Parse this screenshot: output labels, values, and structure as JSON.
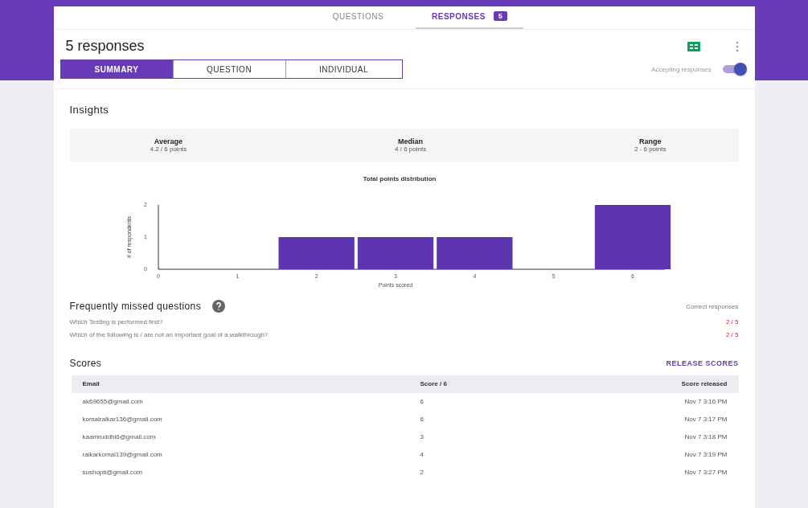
{
  "top_tabs": [
    {
      "label": "QUESTIONS",
      "selected": false
    },
    {
      "label": "RESPONSES",
      "selected": true,
      "badge": "5"
    }
  ],
  "title": "5 responses",
  "views": [
    {
      "label": "SUMMARY",
      "selected": true
    },
    {
      "label": "QUESTION",
      "selected": false
    },
    {
      "label": "INDIVIDUAL",
      "selected": false
    }
  ],
  "accepting": {
    "label": "Accepting responses",
    "on": true
  },
  "insights": {
    "title": "Insights",
    "stats": [
      {
        "label": "Average",
        "value": "4.2 / 6 points"
      },
      {
        "label": "Median",
        "value": "4 / 6 points"
      },
      {
        "label": "Range",
        "value": "2 - 6 points"
      }
    ],
    "chart_data": {
      "type": "bar",
      "title": "Total points distribution",
      "xlabel": "Points scored",
      "ylabel": "# of respondents",
      "categories": [
        "0",
        "1",
        "2",
        "3",
        "4",
        "5",
        "6"
      ],
      "values": [
        0,
        0,
        1,
        1,
        1,
        0,
        2
      ],
      "yticks": [
        0,
        1,
        2
      ],
      "ylim": [
        0,
        2
      ]
    }
  },
  "missed": {
    "title": "Frequently missed questions",
    "column": "Correct responses",
    "rows": [
      {
        "question": "Which Testing is performed first?",
        "correct": "2 / 5"
      },
      {
        "question": "Which of the following is / are not an important goal of a walkthrough?",
        "correct": "2 / 5"
      }
    ]
  },
  "scores": {
    "title": "Scores",
    "action": "RELEASE SCORES",
    "columns": [
      "Email",
      "Score / 6",
      "Score released"
    ],
    "rows": [
      [
        "ak69655@gmail.com",
        "6",
        "Nov 7 3:16 PM"
      ],
      [
        "komalraikar136@gmail.com",
        "6",
        "Nov 7 3:17 PM"
      ],
      [
        "kaamruddhi6@gmail.com",
        "3",
        "Nov 7 3:18 PM"
      ],
      [
        "raikarkomal139@gmail.com",
        "4",
        "Nov 7 3:19 PM"
      ],
      [
        "sushopti@gmail.com",
        "2",
        "Nov 7 3:27 PM"
      ]
    ]
  }
}
